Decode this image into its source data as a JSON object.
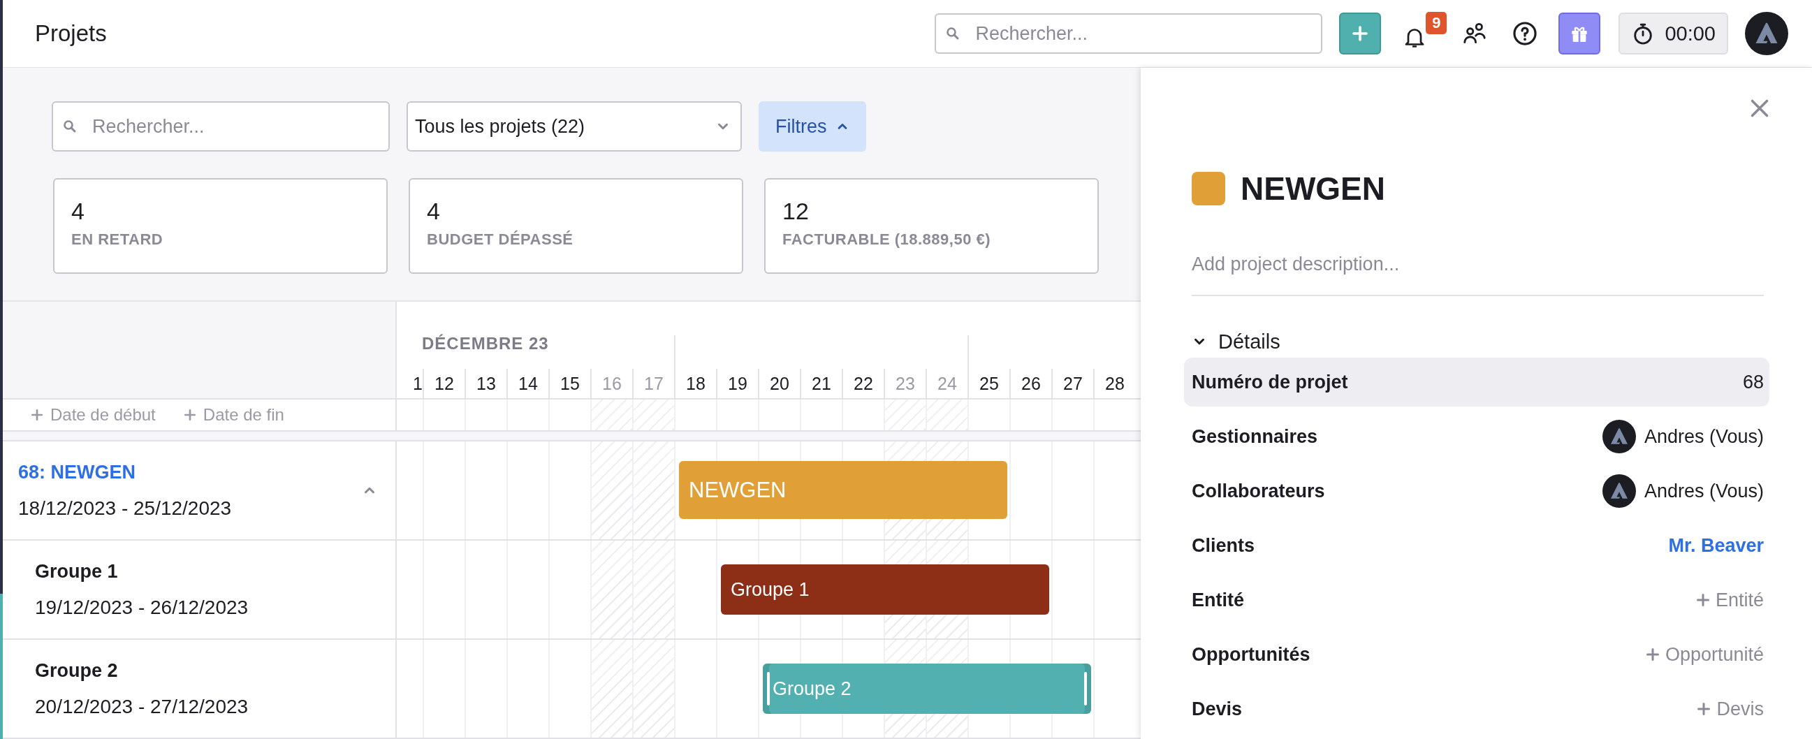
{
  "header": {
    "title": "Projets",
    "search": {
      "placeholder": "Rechercher..."
    },
    "notifications": "9",
    "timer": "00:00"
  },
  "filters": {
    "search": {
      "placeholder": "Rechercher..."
    },
    "project_select": "Tous les projets (22)",
    "filter_button": {
      "label": "Filtres",
      "expanded": true
    }
  },
  "stats": [
    {
      "value": "4",
      "label": "EN RETARD"
    },
    {
      "value": "4",
      "label": "BUDGET DÉPASSÉ"
    },
    {
      "value": "12",
      "label": "FACTURABLE (18.889,50 €)"
    }
  ],
  "timeline": {
    "month": "DÉCEMBRE 23",
    "days": [
      {
        "label": "1",
        "weekend": false
      },
      {
        "label": "12",
        "weekend": false
      },
      {
        "label": "13",
        "weekend": false
      },
      {
        "label": "14",
        "weekend": false
      },
      {
        "label": "15",
        "weekend": false
      },
      {
        "label": "16",
        "weekend": true
      },
      {
        "label": "17",
        "weekend": true
      },
      {
        "label": "18",
        "weekend": false
      },
      {
        "label": "19",
        "weekend": false
      },
      {
        "label": "20",
        "weekend": false
      },
      {
        "label": "21",
        "weekend": false
      },
      {
        "label": "22",
        "weekend": false
      },
      {
        "label": "23",
        "weekend": true
      },
      {
        "label": "24",
        "weekend": true
      },
      {
        "label": "25",
        "weekend": false
      },
      {
        "label": "26",
        "weekend": false
      },
      {
        "label": "27",
        "weekend": false
      },
      {
        "label": "28",
        "weekend": false
      }
    ]
  },
  "date_actions": [
    "Date de début",
    "Date de fin"
  ],
  "projects": [
    {
      "kind": "project",
      "title": "68: NEWGEN",
      "dates": "18/12/2023 - 25/12/2023",
      "expanded": true,
      "bar": {
        "label": "NEWGEN",
        "color": "#e0a037",
        "selected": false
      }
    },
    {
      "kind": "group",
      "title": "Groupe 1",
      "dates": "19/12/2023 - 26/12/2023",
      "bar": {
        "label": "Groupe 1",
        "color": "#8d2e16",
        "selected": false
      }
    },
    {
      "kind": "group",
      "title": "Groupe 2",
      "dates": "20/12/2023 - 27/12/2023",
      "bar": {
        "label": "Groupe 2",
        "color": "#52b0b0",
        "selected": true
      }
    }
  ],
  "panel": {
    "color": "#e0a037",
    "title": "NEWGEN",
    "description": {
      "placeholder": "Add project description..."
    },
    "section": {
      "title": "Détails",
      "expanded": true
    },
    "fields": [
      {
        "label": "Numéro de projet",
        "kind": "text",
        "value": "68",
        "highlighted": true
      },
      {
        "label": "Gestionnaires",
        "kind": "person",
        "value": "Andres (Vous)",
        "highlighted": false
      },
      {
        "label": "Collaborateurs",
        "kind": "person",
        "value": "Andres (Vous)",
        "highlighted": false
      },
      {
        "label": "Clients",
        "kind": "link",
        "value": "Mr. Beaver",
        "highlighted": false
      },
      {
        "label": "Entité",
        "kind": "add",
        "value": "Entité",
        "highlighted": false
      },
      {
        "label": "Opportunités",
        "kind": "add",
        "value": "Opportunité",
        "highlighted": false
      },
      {
        "label": "Devis",
        "kind": "add",
        "value": "Devis",
        "highlighted": false
      }
    ]
  }
}
